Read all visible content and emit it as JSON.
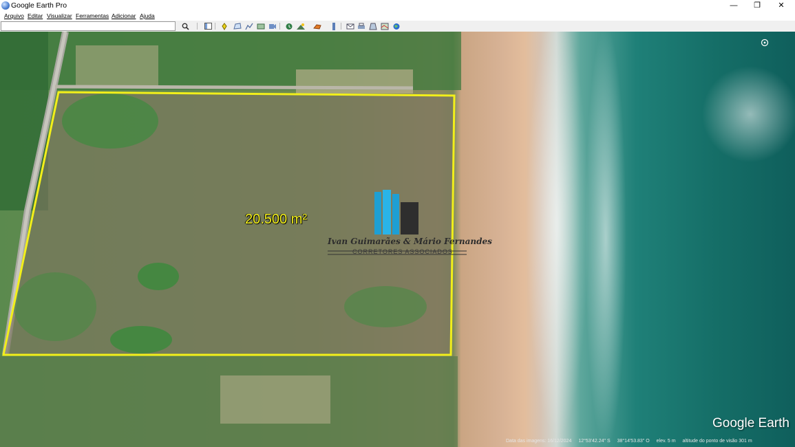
{
  "window": {
    "title": "Google Earth Pro",
    "controls": {
      "minimize": "—",
      "maximize": "❐",
      "close": "✕"
    }
  },
  "menu": [
    "Arquivo",
    "Editar",
    "Visualizar",
    "Ferramentas",
    "Adicionar",
    "Ajuda"
  ],
  "search": {
    "value": "",
    "placeholder": ""
  },
  "toolbar_icons": [
    "search-icon",
    "sidebar-icon",
    "placemark-icon",
    "polygon-icon",
    "path-icon",
    "image-overlay-icon",
    "record-tour-icon",
    "historical-imagery-icon",
    "sunlight-icon",
    "planets-icon",
    "ruler-icon",
    "email-icon",
    "print-icon",
    "save-image-icon",
    "view-in-maps-icon",
    "earth-gallery-icon"
  ],
  "map": {
    "area_label": "20.500 m²",
    "watermark": {
      "name": "Ivan Guimarães & Mário Fernandes",
      "subtitle": "CORRETORES ASSOCIADOS"
    },
    "logo": "Google Earth",
    "status": {
      "imagery_date": "Data das imagens: 16/12/2024",
      "lat": "12°53'42.24\" S",
      "lon": "38°14'53.83\" O",
      "elev": "elev.   5 m",
      "eye_alt": "altitude do ponto de visão   301 m"
    }
  },
  "colors": {
    "polygon": "#f2ef1a",
    "titlebar": "#ffffff",
    "toolbar": "#f0f0f0"
  }
}
